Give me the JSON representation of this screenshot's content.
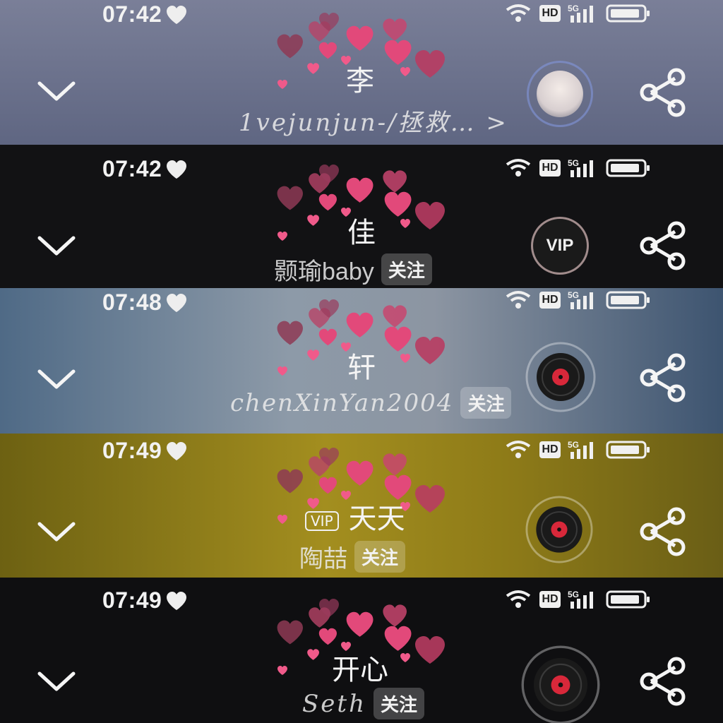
{
  "colors": {
    "heart": "#e2497a",
    "heart_dark": "#8e3a55",
    "text": "#f2f2f2"
  },
  "strips": [
    {
      "time": "07:42",
      "title": "李",
      "subtitle": "1vejunjun-/拯救… >",
      "follow": "",
      "right_widget": "avatar"
    },
    {
      "time": "07:42",
      "title": "佳",
      "subtitle": "颢瑜baby",
      "follow": "关注",
      "right_widget": "vip-badge"
    },
    {
      "time": "07:48",
      "title": "轩",
      "subtitle": "chenXinYan2004",
      "follow": "关注",
      "right_widget": "vinyl-disc"
    },
    {
      "time": "07:49",
      "title_badge": "VIP",
      "title": "天天",
      "subtitle": "陶喆",
      "follow": "关注",
      "right_widget": "vinyl-disc"
    },
    {
      "time": "07:49",
      "title": "开心",
      "subtitle": "Seth",
      "follow": "关注",
      "right_widget": "vinyl-disc"
    }
  ],
  "status_bar": {
    "hd_label": "HD",
    "network": "5G"
  },
  "vip_label": "VIP",
  "icons": [
    "white-heart-icon",
    "wifi-icon",
    "hd-icon",
    "5g-signal-icon",
    "battery-icon",
    "chevron-down-icon",
    "share-icon",
    "hearts-decoration"
  ]
}
